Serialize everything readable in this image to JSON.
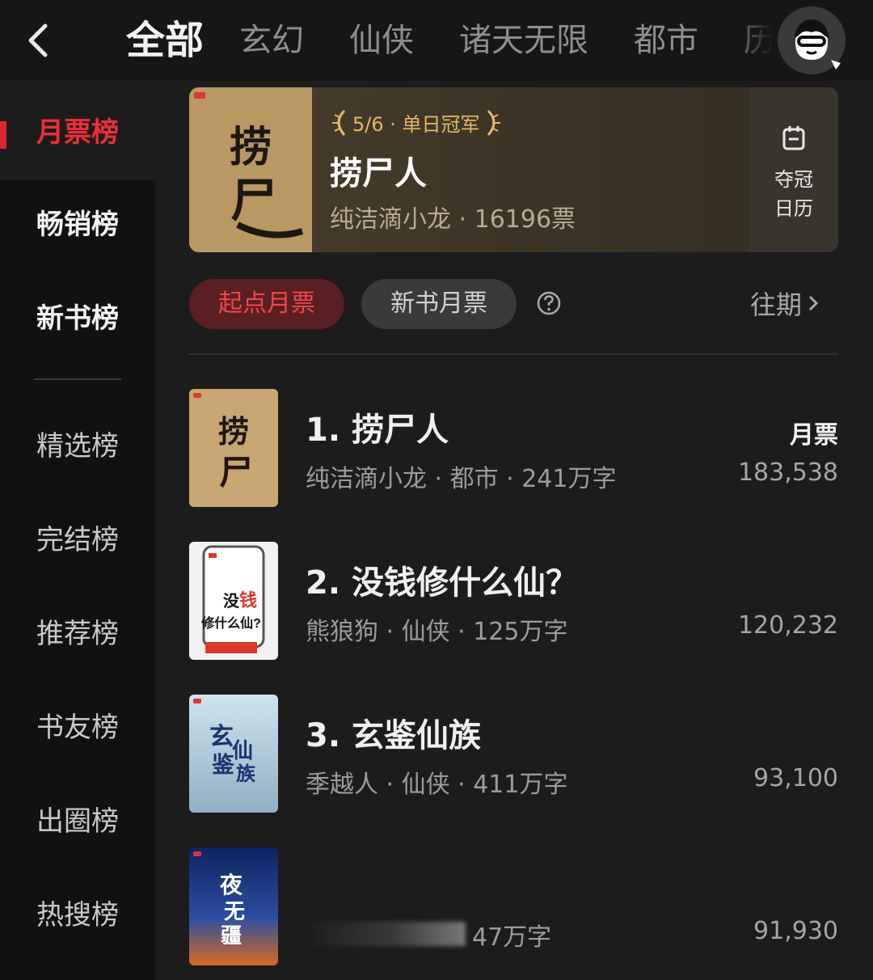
{
  "nav": {
    "tabs": [
      "全部",
      "玄幻",
      "仙侠",
      "诸天无限",
      "都市",
      "历"
    ],
    "active_tab": "全部"
  },
  "sidebar": {
    "items": [
      "月票榜",
      "畅销榜",
      "新书榜",
      "精选榜",
      "完结榜",
      "推荐榜",
      "书友榜",
      "出圈榜",
      "热搜榜"
    ]
  },
  "champion": {
    "badge": "5/6 · 单日冠军",
    "title": "捞尸人",
    "meta": "纯洁滴小龙 · 16196票",
    "calendar_line1": "夺冠",
    "calendar_line2": "日历",
    "cover_text": "捞尸人"
  },
  "filters": {
    "primary": "起点月票",
    "secondary": "新书月票",
    "history": "往期"
  },
  "list": {
    "unit_label": "月票",
    "rows": [
      {
        "title": "1. 捞尸人",
        "meta": "纯洁滴小龙 · 都市 · 241万字",
        "count": "183,538",
        "cover_text": "捞尸人"
      },
      {
        "title": "2. 没钱修什么仙？",
        "meta": "熊狼狗 · 仙侠 · 125万字",
        "count": "120,232",
        "cover_text": "没钱修什么仙?"
      },
      {
        "title": "3. 玄鉴仙族",
        "meta": "季越人 · 仙侠 · 411万字",
        "count": "93,100",
        "cover_text": "玄鉴仙族"
      },
      {
        "title": "",
        "meta": "47万字",
        "count": "91,930",
        "cover_text": "夜无疆"
      }
    ]
  },
  "colors": {
    "accent": "#e0262c",
    "gold": "#e7b866",
    "background": "#1c1c1c"
  }
}
